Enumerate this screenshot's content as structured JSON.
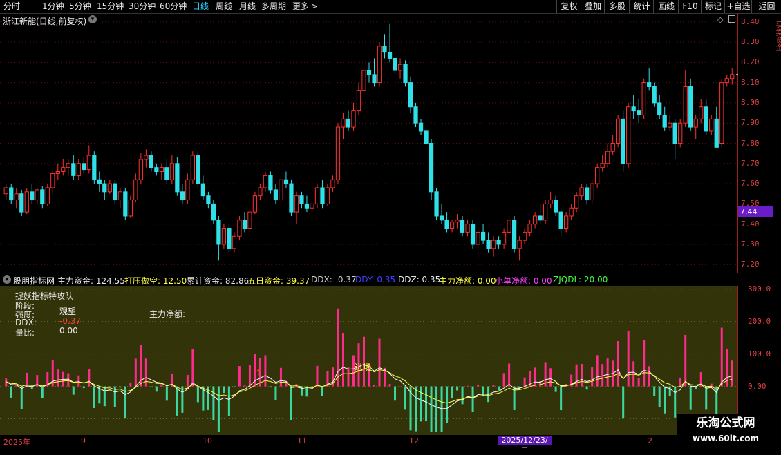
{
  "toolbar": {
    "left_items": [
      "分时",
      "1分钟",
      "5分钟",
      "15分钟",
      "30分钟",
      "60分钟",
      "日线",
      "周线",
      "月线",
      "多周期",
      "更多"
    ],
    "active_item": "日线",
    "right_items": [
      "复权",
      "叠加",
      "多股",
      "统计",
      "画线",
      "F10",
      "标记",
      "+自选",
      "返回"
    ]
  },
  "chart_title": "浙江新能(日线,前复权)",
  "price_axis": [
    "8.40",
    "8.30",
    "8.20",
    "8.10",
    "8.00",
    "7.90",
    "7.80",
    "7.70",
    "7.60",
    "7.50",
    "7.40",
    "7.30",
    "7.20"
  ],
  "current_price": "7.44",
  "indicator_header": {
    "name": "股朋指标网",
    "segments": [
      {
        "text": "主力资金: 124.55",
        "color": "#e8e8e8"
      },
      {
        "text": "打压做空: 12.50",
        "color": "#ffff40"
      },
      {
        "text": "累计资金: 82.86",
        "color": "#e8e8e8"
      },
      {
        "text": "五日资金: 39.37",
        "color": "#ffff40"
      },
      {
        "text": "DDX: -0.37",
        "color": "#cccccc"
      },
      {
        "text": "DDY: 0.35",
        "color": "#4040ff"
      },
      {
        "text": "DDZ: 0.35",
        "color": "#e8e8e8"
      },
      {
        "text": "主力净额: 0.00",
        "color": "#ffff40"
      },
      {
        "text": "小单净额: 0.00",
        "color": "#ff40ff"
      },
      {
        "text": "ZJQDL: 20.00",
        "color": "#40ff40"
      }
    ]
  },
  "indicator_overlay": {
    "title": "捉妖指标特攻队",
    "stage_label": "阶段:",
    "strength_label": "强度:",
    "strength_value": "观望",
    "ddx_label": "DDX:",
    "ddx_value": "-0.37",
    "volratio_label": "量比:",
    "volratio_value": "0.00",
    "main_net_label": "主力净额:",
    "entry_label": "进场"
  },
  "indicator_axis": [
    "300.0",
    "200.0",
    "100.0",
    "0.00",
    "-100.0"
  ],
  "xaxis": {
    "labels": [
      {
        "text": "2025年",
        "x": 5
      },
      {
        "text": "9",
        "x": 117
      },
      {
        "text": "10",
        "x": 293
      },
      {
        "text": "11",
        "x": 430
      },
      {
        "text": "12",
        "x": 592
      },
      {
        "text": "2",
        "x": 937
      }
    ],
    "highlight_date": "2025/12/23/二"
  },
  "watermark": {
    "title": "乐淘公式网",
    "url": "www.60lt.com"
  },
  "side_strip_text": "买卖资金",
  "chart_data": {
    "type": "candlestick",
    "y_range": [
      7.16,
      8.44
    ],
    "colors": {
      "up": "#ff3030",
      "down": "#30e0e8"
    },
    "candles": [
      [
        7.55,
        7.6,
        7.52,
        7.58
      ],
      [
        7.58,
        7.6,
        7.5,
        7.52
      ],
      [
        7.52,
        7.58,
        7.48,
        7.55
      ],
      [
        7.55,
        7.57,
        7.44,
        7.46
      ],
      [
        7.46,
        7.58,
        7.45,
        7.56
      ],
      [
        7.56,
        7.6,
        7.5,
        7.52
      ],
      [
        7.52,
        7.58,
        7.5,
        7.57
      ],
      [
        7.57,
        7.59,
        7.48,
        7.5
      ],
      [
        7.5,
        7.6,
        7.49,
        7.58
      ],
      [
        7.58,
        7.67,
        7.55,
        7.65
      ],
      [
        7.65,
        7.7,
        7.62,
        7.66
      ],
      [
        7.66,
        7.72,
        7.64,
        7.68
      ],
      [
        7.68,
        7.72,
        7.64,
        7.7
      ],
      [
        7.7,
        7.74,
        7.62,
        7.64
      ],
      [
        7.64,
        7.72,
        7.62,
        7.7
      ],
      [
        7.7,
        7.73,
        7.65,
        7.67
      ],
      [
        7.67,
        7.79,
        7.65,
        7.74
      ],
      [
        7.74,
        7.76,
        7.6,
        7.62
      ],
      [
        7.62,
        7.66,
        7.56,
        7.6
      ],
      [
        7.6,
        7.62,
        7.52,
        7.56
      ],
      [
        7.56,
        7.62,
        7.55,
        7.6
      ],
      [
        7.6,
        7.62,
        7.5,
        7.52
      ],
      [
        7.52,
        7.58,
        7.48,
        7.56
      ],
      [
        7.56,
        7.58,
        7.42,
        7.44
      ],
      [
        7.44,
        7.54,
        7.43,
        7.52
      ],
      [
        7.52,
        7.65,
        7.51,
        7.62
      ],
      [
        7.62,
        7.75,
        7.6,
        7.72
      ],
      [
        7.72,
        7.77,
        7.68,
        7.74
      ],
      [
        7.74,
        7.76,
        7.66,
        7.68
      ],
      [
        7.68,
        7.7,
        7.64,
        7.66
      ],
      [
        7.66,
        7.7,
        7.62,
        7.68
      ],
      [
        7.68,
        7.72,
        7.6,
        7.62
      ],
      [
        7.62,
        7.74,
        7.6,
        7.7
      ],
      [
        7.7,
        7.73,
        7.54,
        7.56
      ],
      [
        7.56,
        7.6,
        7.5,
        7.52
      ],
      [
        7.52,
        7.65,
        7.5,
        7.62
      ],
      [
        7.62,
        7.76,
        7.6,
        7.74
      ],
      [
        7.74,
        7.76,
        7.58,
        7.6
      ],
      [
        7.6,
        7.64,
        7.52,
        7.54
      ],
      [
        7.54,
        7.56,
        7.48,
        7.5
      ],
      [
        7.5,
        7.52,
        7.4,
        7.42
      ],
      [
        7.42,
        7.44,
        7.22,
        7.3
      ],
      [
        7.3,
        7.4,
        7.28,
        7.38
      ],
      [
        7.38,
        7.4,
        7.26,
        7.28
      ],
      [
        7.28,
        7.36,
        7.26,
        7.34
      ],
      [
        7.34,
        7.44,
        7.32,
        7.42
      ],
      [
        7.42,
        7.46,
        7.36,
        7.38
      ],
      [
        7.38,
        7.48,
        7.36,
        7.46
      ],
      [
        7.46,
        7.56,
        7.45,
        7.54
      ],
      [
        7.54,
        7.6,
        7.52,
        7.58
      ],
      [
        7.58,
        7.66,
        7.56,
        7.64
      ],
      [
        7.64,
        7.66,
        7.55,
        7.57
      ],
      [
        7.57,
        7.6,
        7.5,
        7.52
      ],
      [
        7.52,
        7.64,
        7.51,
        7.62
      ],
      [
        7.62,
        7.66,
        7.58,
        7.6
      ],
      [
        7.6,
        7.62,
        7.44,
        7.46
      ],
      [
        7.46,
        7.56,
        7.4,
        7.54
      ],
      [
        7.54,
        7.56,
        7.48,
        7.5
      ],
      [
        7.5,
        7.54,
        7.46,
        7.48
      ],
      [
        7.48,
        7.52,
        7.46,
        7.5
      ],
      [
        7.5,
        7.6,
        7.48,
        7.58
      ],
      [
        7.58,
        7.62,
        7.48,
        7.5
      ],
      [
        7.5,
        7.6,
        7.49,
        7.58
      ],
      [
        7.58,
        7.64,
        7.56,
        7.62
      ],
      [
        7.62,
        7.9,
        7.6,
        7.88
      ],
      [
        7.88,
        7.95,
        7.82,
        7.92
      ],
      [
        7.92,
        7.96,
        7.86,
        7.88
      ],
      [
        7.88,
        8.0,
        7.86,
        7.96
      ],
      [
        7.96,
        8.1,
        7.94,
        8.06
      ],
      [
        8.06,
        8.2,
        8.02,
        8.16
      ],
      [
        8.16,
        8.2,
        8.1,
        8.14
      ],
      [
        8.14,
        8.22,
        8.08,
        8.1
      ],
      [
        8.1,
        8.3,
        8.08,
        8.28
      ],
      [
        8.28,
        8.34,
        8.22,
        8.25
      ],
      [
        8.25,
        8.39,
        8.2,
        8.22
      ],
      [
        8.22,
        8.26,
        8.14,
        8.16
      ],
      [
        8.16,
        8.22,
        8.12,
        8.19
      ],
      [
        8.19,
        8.21,
        8.08,
        8.1
      ],
      [
        8.1,
        8.13,
        7.95,
        7.98
      ],
      [
        7.98,
        8.0,
        7.88,
        7.9
      ],
      [
        7.9,
        7.92,
        7.84,
        7.86
      ],
      [
        7.86,
        7.88,
        7.78,
        7.8
      ],
      [
        7.8,
        7.82,
        7.52,
        7.56
      ],
      [
        7.56,
        7.58,
        7.42,
        7.44
      ],
      [
        7.44,
        7.5,
        7.4,
        7.42
      ],
      [
        7.42,
        7.46,
        7.36,
        7.38
      ],
      [
        7.38,
        7.42,
        7.36,
        7.41
      ],
      [
        7.41,
        7.45,
        7.38,
        7.42
      ],
      [
        7.42,
        7.44,
        7.34,
        7.36
      ],
      [
        7.36,
        7.42,
        7.34,
        7.4
      ],
      [
        7.4,
        7.42,
        7.28,
        7.3
      ],
      [
        7.3,
        7.38,
        7.22,
        7.36
      ],
      [
        7.36,
        7.4,
        7.3,
        7.32
      ],
      [
        7.32,
        7.36,
        7.26,
        7.28
      ],
      [
        7.28,
        7.34,
        7.24,
        7.32
      ],
      [
        7.32,
        7.34,
        7.28,
        7.3
      ],
      [
        7.3,
        7.38,
        7.28,
        7.36
      ],
      [
        7.36,
        7.44,
        7.34,
        7.42
      ],
      [
        7.42,
        7.44,
        7.26,
        7.28
      ],
      [
        7.28,
        7.34,
        7.22,
        7.32
      ],
      [
        7.32,
        7.38,
        7.3,
        7.36
      ],
      [
        7.36,
        7.42,
        7.34,
        7.4
      ],
      [
        7.4,
        7.46,
        7.38,
        7.44
      ],
      [
        7.44,
        7.5,
        7.4,
        7.42
      ],
      [
        7.42,
        7.52,
        7.4,
        7.5
      ],
      [
        7.5,
        7.56,
        7.48,
        7.52
      ],
      [
        7.52,
        7.54,
        7.44,
        7.46
      ],
      [
        7.46,
        7.48,
        7.34,
        7.38
      ],
      [
        7.38,
        7.46,
        7.36,
        7.44
      ],
      [
        7.44,
        7.5,
        7.42,
        7.48
      ],
      [
        7.48,
        7.56,
        7.46,
        7.54
      ],
      [
        7.54,
        7.6,
        7.52,
        7.58
      ],
      [
        7.58,
        7.6,
        7.5,
        7.52
      ],
      [
        7.52,
        7.62,
        7.5,
        7.6
      ],
      [
        7.6,
        7.7,
        7.58,
        7.68
      ],
      [
        7.68,
        7.74,
        7.66,
        7.7
      ],
      [
        7.7,
        7.8,
        7.68,
        7.76
      ],
      [
        7.76,
        7.84,
        7.74,
        7.8
      ],
      [
        7.8,
        7.94,
        7.78,
        7.92
      ],
      [
        7.92,
        7.96,
        7.66,
        7.7
      ],
      [
        7.7,
        8.0,
        7.68,
        7.98
      ],
      [
        7.98,
        8.04,
        7.92,
        7.96
      ],
      [
        7.96,
        8.02,
        7.9,
        7.94
      ],
      [
        7.94,
        8.12,
        7.92,
        8.1
      ],
      [
        8.1,
        8.17,
        8.06,
        8.08
      ],
      [
        8.08,
        8.1,
        7.98,
        8.0
      ],
      [
        8.0,
        8.04,
        7.92,
        7.94
      ],
      [
        7.94,
        7.98,
        7.86,
        7.88
      ],
      [
        7.88,
        7.94,
        7.86,
        7.9
      ],
      [
        7.9,
        7.92,
        7.72,
        7.8
      ],
      [
        7.8,
        7.92,
        7.78,
        7.9
      ],
      [
        7.9,
        8.16,
        7.88,
        8.08
      ],
      [
        8.08,
        8.12,
        7.86,
        7.88
      ],
      [
        7.88,
        7.94,
        7.82,
        7.92
      ],
      [
        7.92,
        8.02,
        7.9,
        7.98
      ],
      [
        7.98,
        8.02,
        7.84,
        7.86
      ],
      [
        7.86,
        7.94,
        7.84,
        7.92
      ],
      [
        7.92,
        7.98,
        7.8,
        7.78
      ],
      [
        7.8,
        8.12,
        7.78,
        8.1
      ],
      [
        8.1,
        8.14,
        8.08,
        8.12
      ],
      [
        8.12,
        8.17,
        8.09,
        8.14
      ]
    ]
  }
}
